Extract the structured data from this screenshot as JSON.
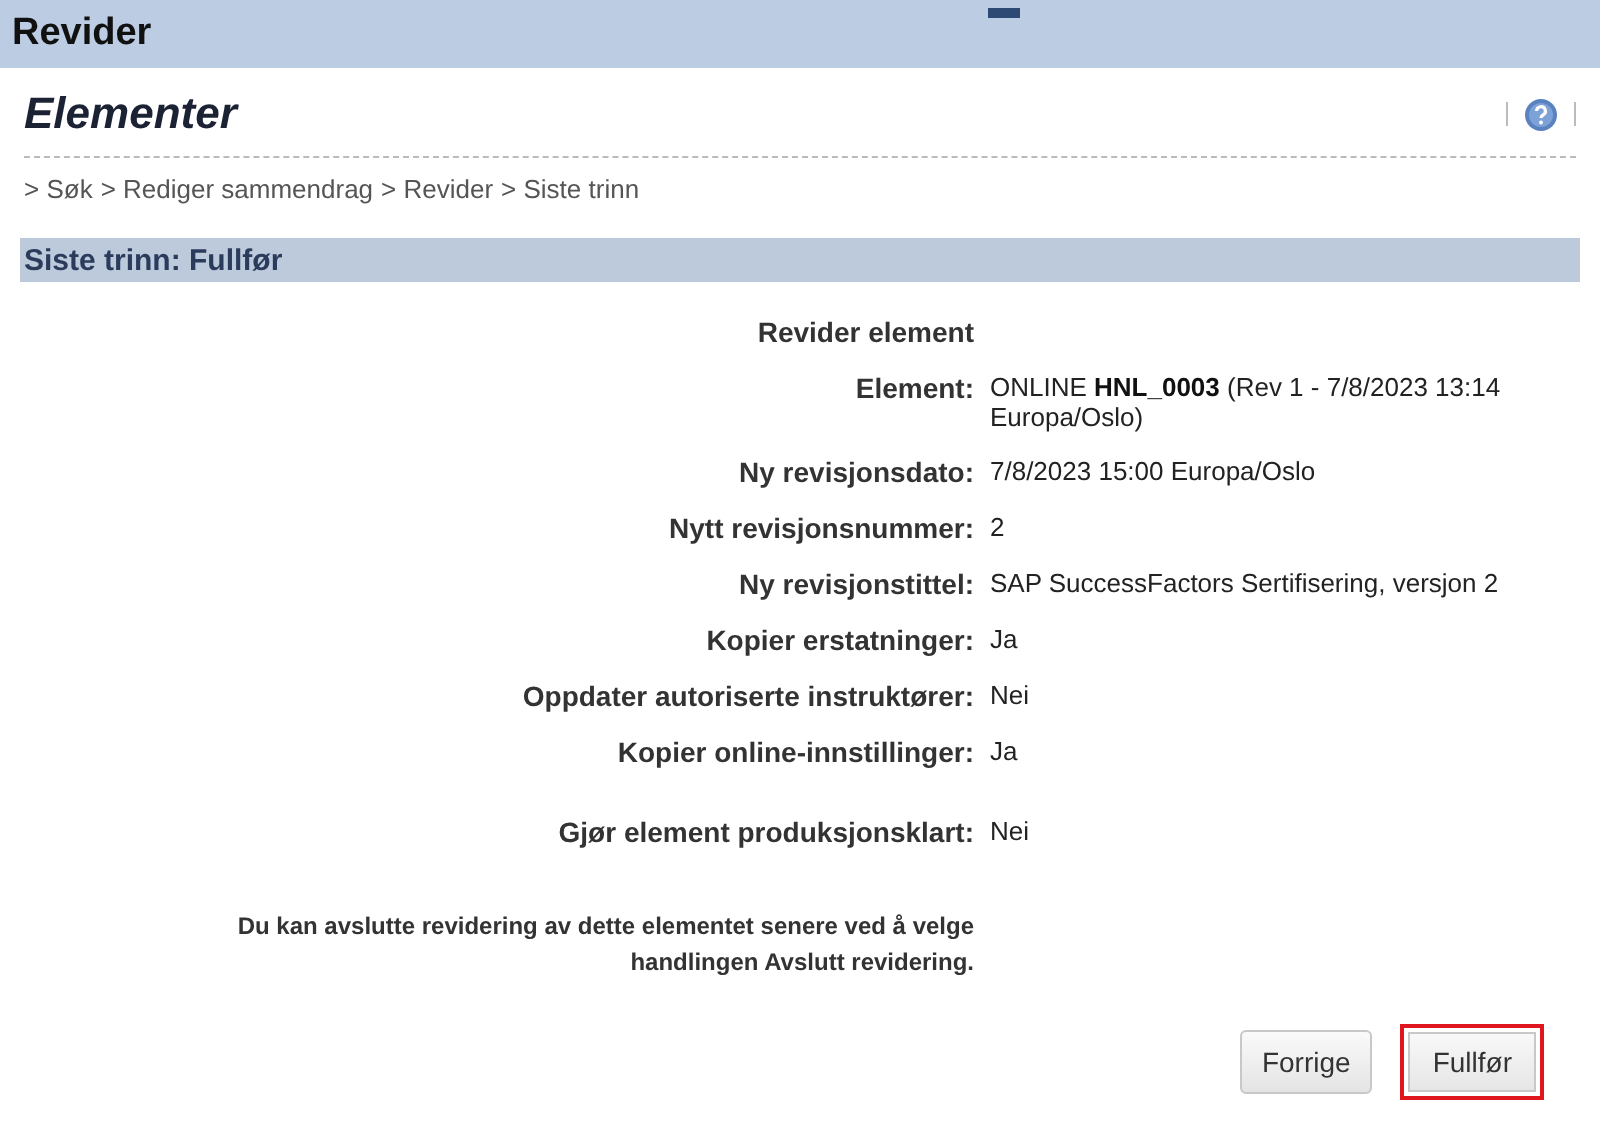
{
  "window": {
    "title": "Revider"
  },
  "page": {
    "title": "Elementer"
  },
  "breadcrumb": [
    "> Søk",
    "> Rediger sammendrag",
    "> Revider",
    "> Siste trinn"
  ],
  "section": {
    "title": "Siste trinn: Fullfør"
  },
  "form": {
    "heading": "Revider element",
    "row_groups": [
      {
        "rows": [
          {
            "label": "Element:",
            "value": "ONLINE **HNL_0003** (Rev 1 - 7/8/2023 13:14 Europa/Oslo)"
          },
          {
            "label": "Ny revisjonsdato:",
            "value": "7/8/2023 15:00 Europa/Oslo"
          },
          {
            "label": "Nytt revisjonsnummer:",
            "value": "2"
          },
          {
            "label": "Ny revisjonstittel:",
            "value": "SAP SuccessFactors Sertifisering, versjon 2"
          },
          {
            "label": "Kopier erstatninger:",
            "value": "Ja"
          },
          {
            "label": "Oppdater autoriserte instruktører:",
            "value": "Nei"
          },
          {
            "label": "Kopier online-innstillinger:",
            "value": "Ja"
          }
        ]
      },
      {
        "rows": [
          {
            "label": "Gjør element produksjonsklart:",
            "value": "Nei"
          }
        ]
      }
    ],
    "note": "Du kan avslutte revidering av dette elementet senere ved å velge handlingen Avslutt revidering."
  },
  "buttons": [
    {
      "label": "Forrige",
      "highlighted": false
    },
    {
      "label": "Fullfør",
      "highlighted": true
    }
  ]
}
